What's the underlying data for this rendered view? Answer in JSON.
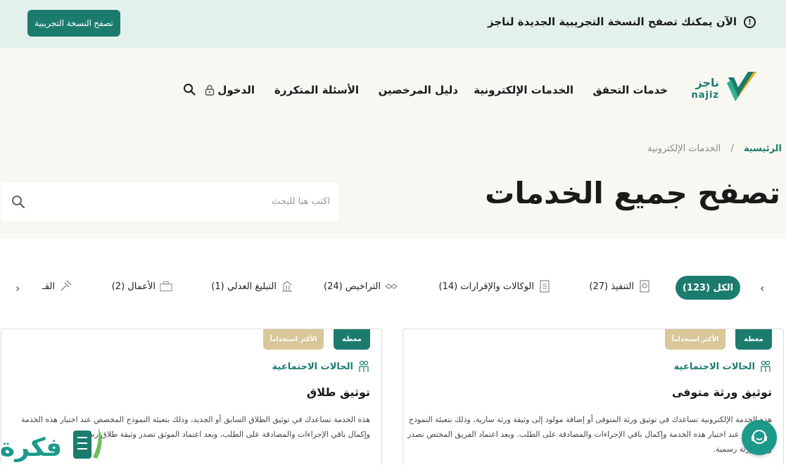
{
  "banner": {
    "message": "الآن يمكنك تصفح النسخة التجريبية الجديدة لناجز",
    "button_label": "تصفح النسخة التجريبية"
  },
  "logo": {
    "arabic": "ناجز",
    "latin": "najiz"
  },
  "nav": {
    "items": [
      "خدمات التحقق",
      "الخدمات الإلكترونية",
      "دليل المرخصين",
      "الأسئلة المتكررة"
    ],
    "login": "الدخول"
  },
  "breadcrumb": {
    "home": "الرئيسية",
    "separator": "/",
    "current": "الخدمات الإلكترونية"
  },
  "page": {
    "title": "تصفح جميع الخدمات"
  },
  "search": {
    "placeholder": "اكتب هنا للبحث"
  },
  "tabs": [
    {
      "label": "الكل (123)",
      "active": true
    },
    {
      "label": "التنفيذ (27)"
    },
    {
      "label": "الوكالات والإقرارات (14)"
    },
    {
      "label": "التراخيص (24)"
    },
    {
      "label": "التبليغ العدلي (1)"
    },
    {
      "label": "الأعمال (2)"
    },
    {
      "label": "القـ"
    }
  ],
  "cards": [
    {
      "badge_main": "معطة",
      "badge_popular": "الأكثر استخداماً",
      "category": "الحالات الاجتماعية",
      "title": "توثيق ورثة متوفى",
      "description": "هذه الخدمة الإلكترونية تساعدك في توثيق ورثة المتوفى أو إضافة مولود إلى وثيقة ورثة سارية، وذلك بتعبئة النموذج المخصص عند اختيار هذه الخدمة وإكمال باقي الإجراءات والمصادقة على الطلب. وبعد اعتماد الفريق المختص تصدر وثيقة ورثة رسمية."
    },
    {
      "badge_main": "معطة",
      "badge_popular": "الأكثر استخداماً",
      "category": "الحالات الاجتماعية",
      "title": "توثيق طلاق",
      "description": "هذه الخدمة تساعدك في توثيق الطلاق السابق أو الجديد، وذلك بتعبئة النموذج المخصص عند اختيار هذه الخدمة وإكمال باقي الإجراءات والمصادقة على الطلب، وبعد اعتماد الموثق تصدر وثيقة طلاق رسمية."
    }
  ],
  "watermark": "فكرة",
  "colors": {
    "primary": "#1b7c6e",
    "gold": "#d9c79a",
    "banner_bg": "#e3f1ec",
    "hero_bg": "#f8f7f2"
  }
}
